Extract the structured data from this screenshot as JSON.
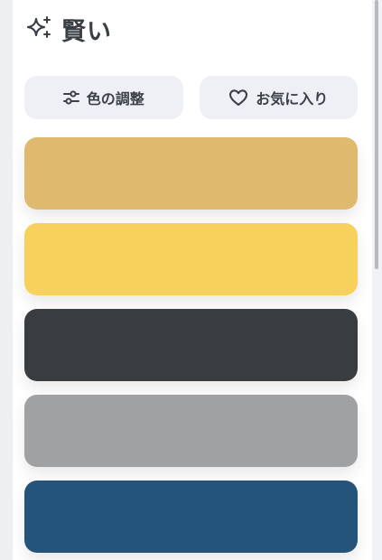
{
  "header": {
    "icon": "sparkle-icon",
    "title": "賢い"
  },
  "buttons": [
    {
      "label": "色の調整",
      "icon": "sliders-icon"
    },
    {
      "label": "お気に入り",
      "icon": "heart-icon"
    }
  ],
  "palette": [
    {
      "color": "#dfb96e"
    },
    {
      "color": "#f8d15c"
    },
    {
      "color": "#3a3d40"
    },
    {
      "color": "#a0a1a3"
    },
    {
      "color": "#245479"
    }
  ],
  "colors": {
    "text": "#3a3f45",
    "button_bg": "#eef0f5"
  }
}
